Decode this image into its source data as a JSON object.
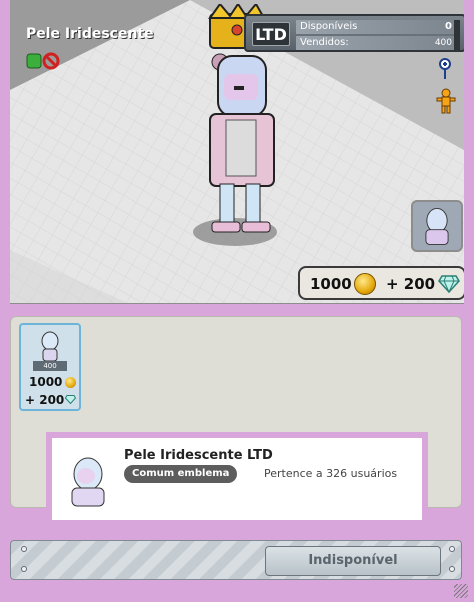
{
  "product": {
    "name": "Pele Iridescente"
  },
  "ltd": {
    "badge": "LTD",
    "available_label": "Disponíveis",
    "available_value": "0",
    "sold_label": "Vendidos:",
    "sold_value": "400"
  },
  "price": {
    "credits": "1000",
    "diamonds": "+ 200"
  },
  "grid": {
    "items": [
      {
        "tag": "400",
        "credits": "1000",
        "diamonds": "+ 200"
      }
    ]
  },
  "tooltip": {
    "title": "Pele Iridescente LTD",
    "badge": "Comum emblema",
    "owners": "Pertence a 326 usuários"
  },
  "footer": {
    "buy_label": "Indisponível"
  },
  "icons": {
    "zoom": "zoom-in-icon",
    "avatar": "avatar-icon",
    "credits": "coin-icon",
    "diamonds": "diamond-icon",
    "status": "no-trade-icon"
  },
  "colors": {
    "frame": "#d9a6db",
    "room_floor": "#e4e4e4",
    "grid_highlight": "#6db5d8"
  }
}
